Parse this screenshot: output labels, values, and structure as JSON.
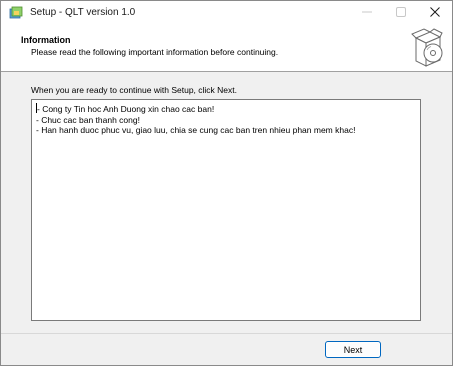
{
  "window": {
    "title": "Setup - QLT version 1.0",
    "icons": {
      "app": "setup-app-icon",
      "minimize": "minimize-icon",
      "maximize": "maximize-icon",
      "close": "close-icon"
    }
  },
  "header": {
    "title": "Information",
    "subtitle": "Please read the following important information before continuing.",
    "image_icon": "software-box-cd-icon"
  },
  "body": {
    "instruction": "When you are ready to continue with Setup, click Next.",
    "info_lines": [
      "- Cong ty Tin hoc Anh Duong xin chao cac ban!",
      "- Chuc cac ban thanh cong!",
      "- Han hanh duoc phuc vu, giao luu, chia se cung cac ban tren nhieu phan mem khac!"
    ]
  },
  "footer": {
    "next_label": "Next"
  },
  "colors": {
    "accent": "#0067c0",
    "window_bg": "#f0f0f0",
    "panel_bg": "#ffffff"
  }
}
